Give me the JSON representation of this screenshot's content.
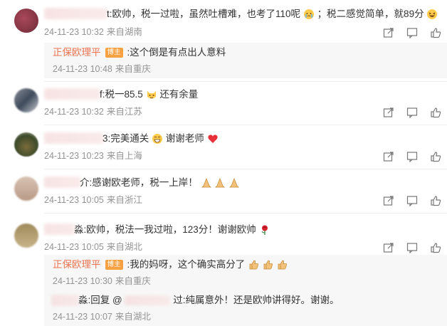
{
  "comments": [
    {
      "text_a": "t:欧帅，税一过啦，虽然吐槽难，也考了110呢",
      "text_b": "；税二感觉简单，就89分",
      "time": "24-11-23 10:32",
      "source": "来自湖南",
      "reply": {
        "author": "正保欧理平",
        "badge": "博主",
        "text": ":这个倒是有点出人意料",
        "time": "24-11-23 10:48",
        "source": "来自重庆"
      }
    },
    {
      "text_a": "f:税一85.5",
      "text_b": "还有余量",
      "time": "24-11-23 10:32",
      "source": "来自江苏"
    },
    {
      "text_a": "3:完美通关",
      "text_b": "谢谢老师",
      "time": "24-11-23 10:23",
      "source": "来自上海"
    },
    {
      "text_a": "介:感谢欧老师，税一上岸！",
      "time": "24-11-23 10:05",
      "source": "来自浙江"
    },
    {
      "text_a": "淼:欧帅，税法一我过啦，123分！谢谢欧帅",
      "time": "24-11-23 10:05",
      "source": "来自湖北",
      "replies": [
        {
          "author": "正保欧理平",
          "badge": "博主",
          "text": ":我的妈呀，这个确实高分了",
          "time": "24-11-23 10:30",
          "source": "来自重庆"
        },
        {
          "text_a": "淼:回复 @",
          "text_b": "过:纯属意外！还是欧帅讲得好。谢谢。",
          "time": "24-11-23 10:07",
          "source": "来自湖北"
        }
      ]
    }
  ],
  "icons": [
    "share-icon",
    "reply-icon",
    "like-icon"
  ],
  "colors": {
    "author": "#eb7350",
    "badge": "#f6a243",
    "meta": "#939393",
    "reply_bg": "#f7f7f7"
  }
}
